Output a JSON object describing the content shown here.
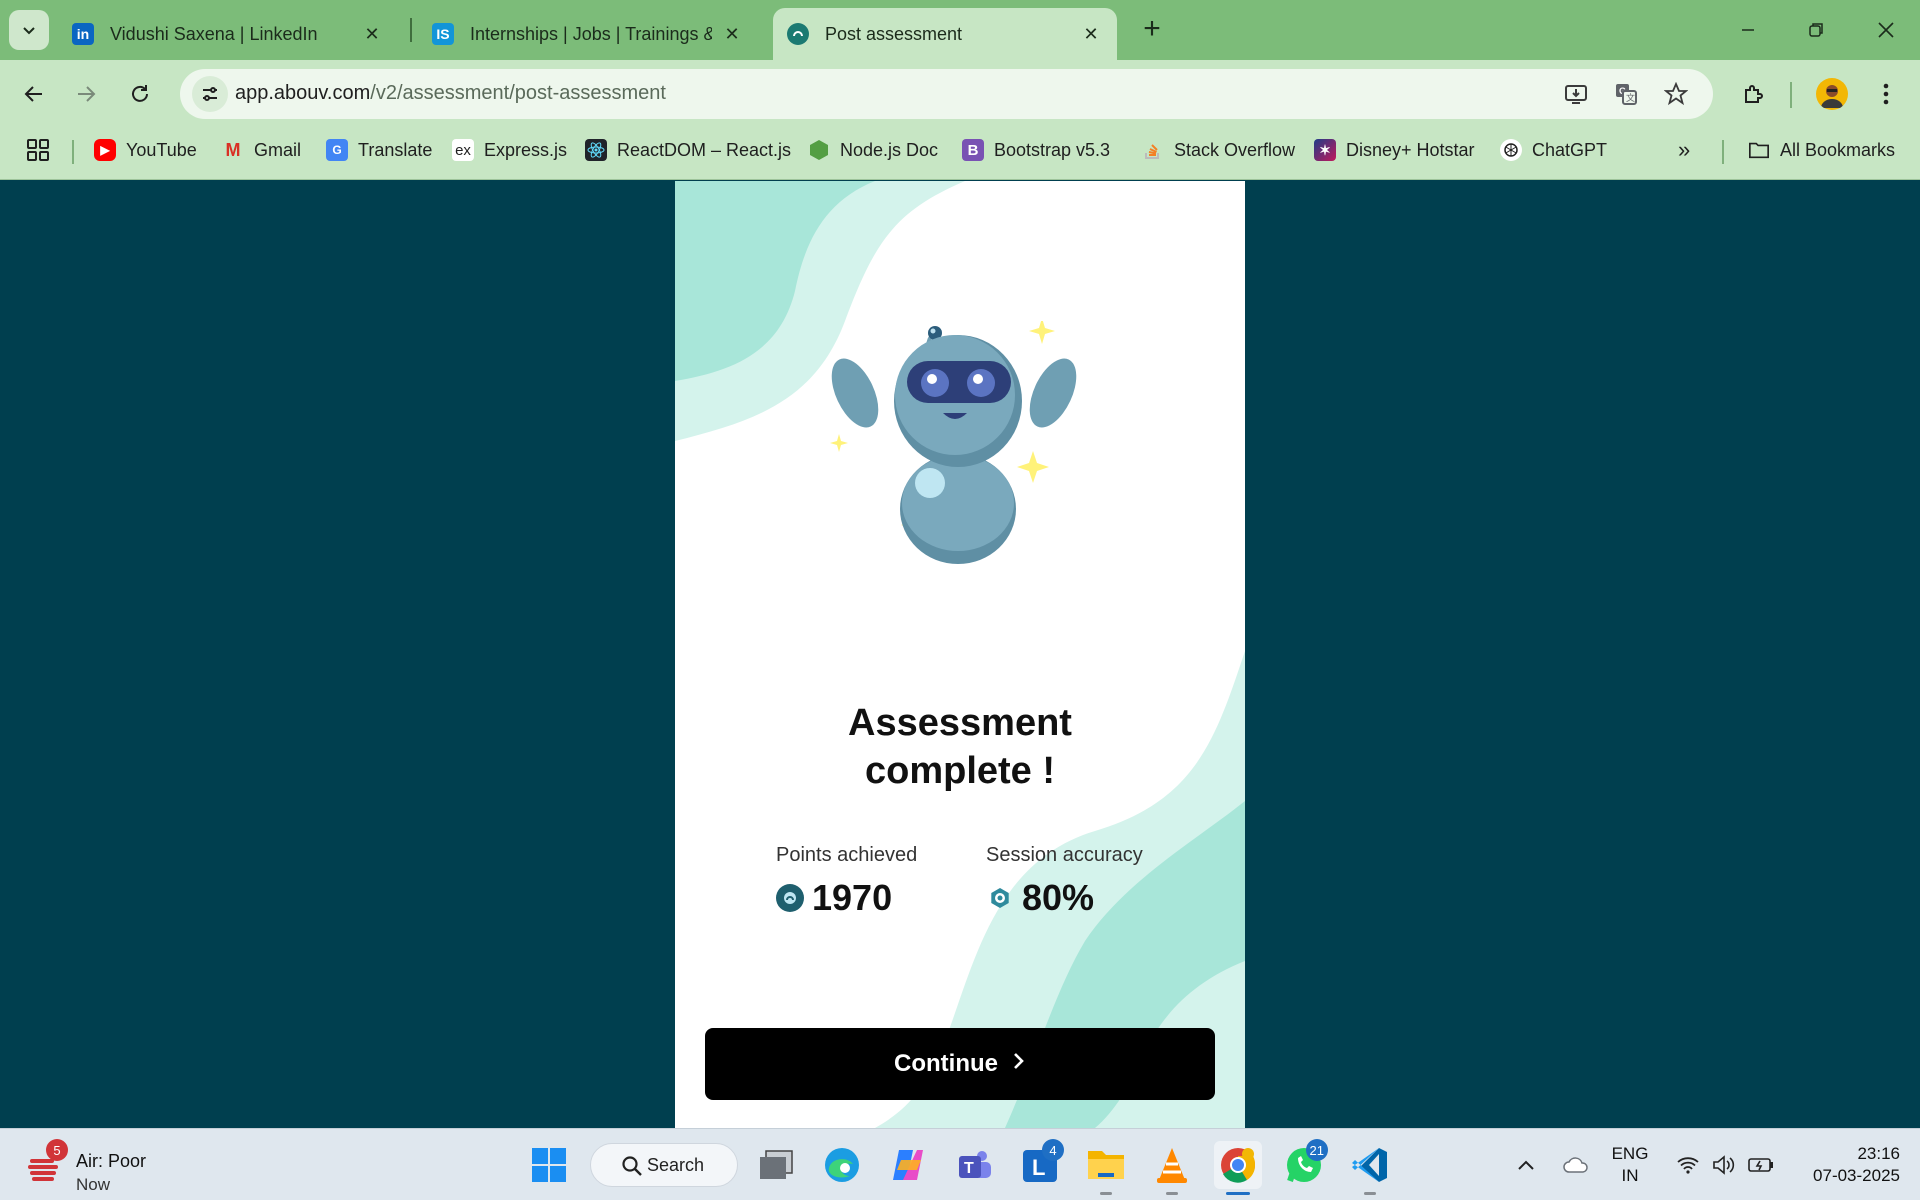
{
  "tabs": [
    {
      "title": "Vidushi Saxena | LinkedIn",
      "icon": "linkedin-icon"
    },
    {
      "title": "Internships | Jobs | Trainings & I",
      "icon": "internshala-icon"
    },
    {
      "title": "Post assessment",
      "icon": "abouv-icon",
      "active": true
    }
  ],
  "address": {
    "host": "app.abouv.com",
    "path": "/v2/assessment/post-assessment"
  },
  "bookmarks": [
    {
      "label": "YouTube",
      "icon": "youtube-icon"
    },
    {
      "label": "Gmail",
      "icon": "gmail-icon"
    },
    {
      "label": "Translate",
      "icon": "translate-icon"
    },
    {
      "label": "Express.js",
      "icon": "express-icon"
    },
    {
      "label": "ReactDOM – React.js",
      "icon": "react-icon"
    },
    {
      "label": "Node.js Doc",
      "icon": "nodejs-icon"
    },
    {
      "label": "Bootstrap v5.3",
      "icon": "bootstrap-icon"
    },
    {
      "label": "Stack Overflow",
      "icon": "stackoverflow-icon"
    },
    {
      "label": "Disney+ Hotstar",
      "icon": "hotstar-icon"
    },
    {
      "label": "ChatGPT",
      "icon": "chatgpt-icon"
    }
  ],
  "bookmarks_all": "All Bookmarks",
  "assessment": {
    "heading_line1": "Assessment",
    "heading_line2": "complete !",
    "points_label": "Points achieved",
    "points_value": "1970",
    "accuracy_label": "Session accuracy",
    "accuracy_value": "80%",
    "continue_label": "Continue"
  },
  "colors": {
    "page_bg": "#003f4f",
    "tab_strip": "#7cbc79",
    "toolbar": "#c7e6c4",
    "wave_light": "#a8e6d9",
    "wave_lighter": "#d4f3ec",
    "robot_body": "#7aa9bd",
    "button_bg": "#000000"
  },
  "taskbar": {
    "weather_title": "Air: Poor",
    "weather_sub": "Now",
    "weather_badge": "5",
    "search_label": "Search",
    "apps": [
      {
        "name": "task-view-icon"
      },
      {
        "name": "edge-icon"
      },
      {
        "name": "copilot-icon"
      },
      {
        "name": "teams-icon"
      },
      {
        "name": "launcher-app-icon",
        "badge": "4"
      },
      {
        "name": "file-explorer-icon"
      },
      {
        "name": "vlc-icon"
      },
      {
        "name": "chrome-icon",
        "active": true
      },
      {
        "name": "whatsapp-icon",
        "badge": "21"
      },
      {
        "name": "vscode-icon"
      }
    ],
    "lang_line1": "ENG",
    "lang_line2": "IN",
    "time": "23:16",
    "date": "07-03-2025"
  }
}
